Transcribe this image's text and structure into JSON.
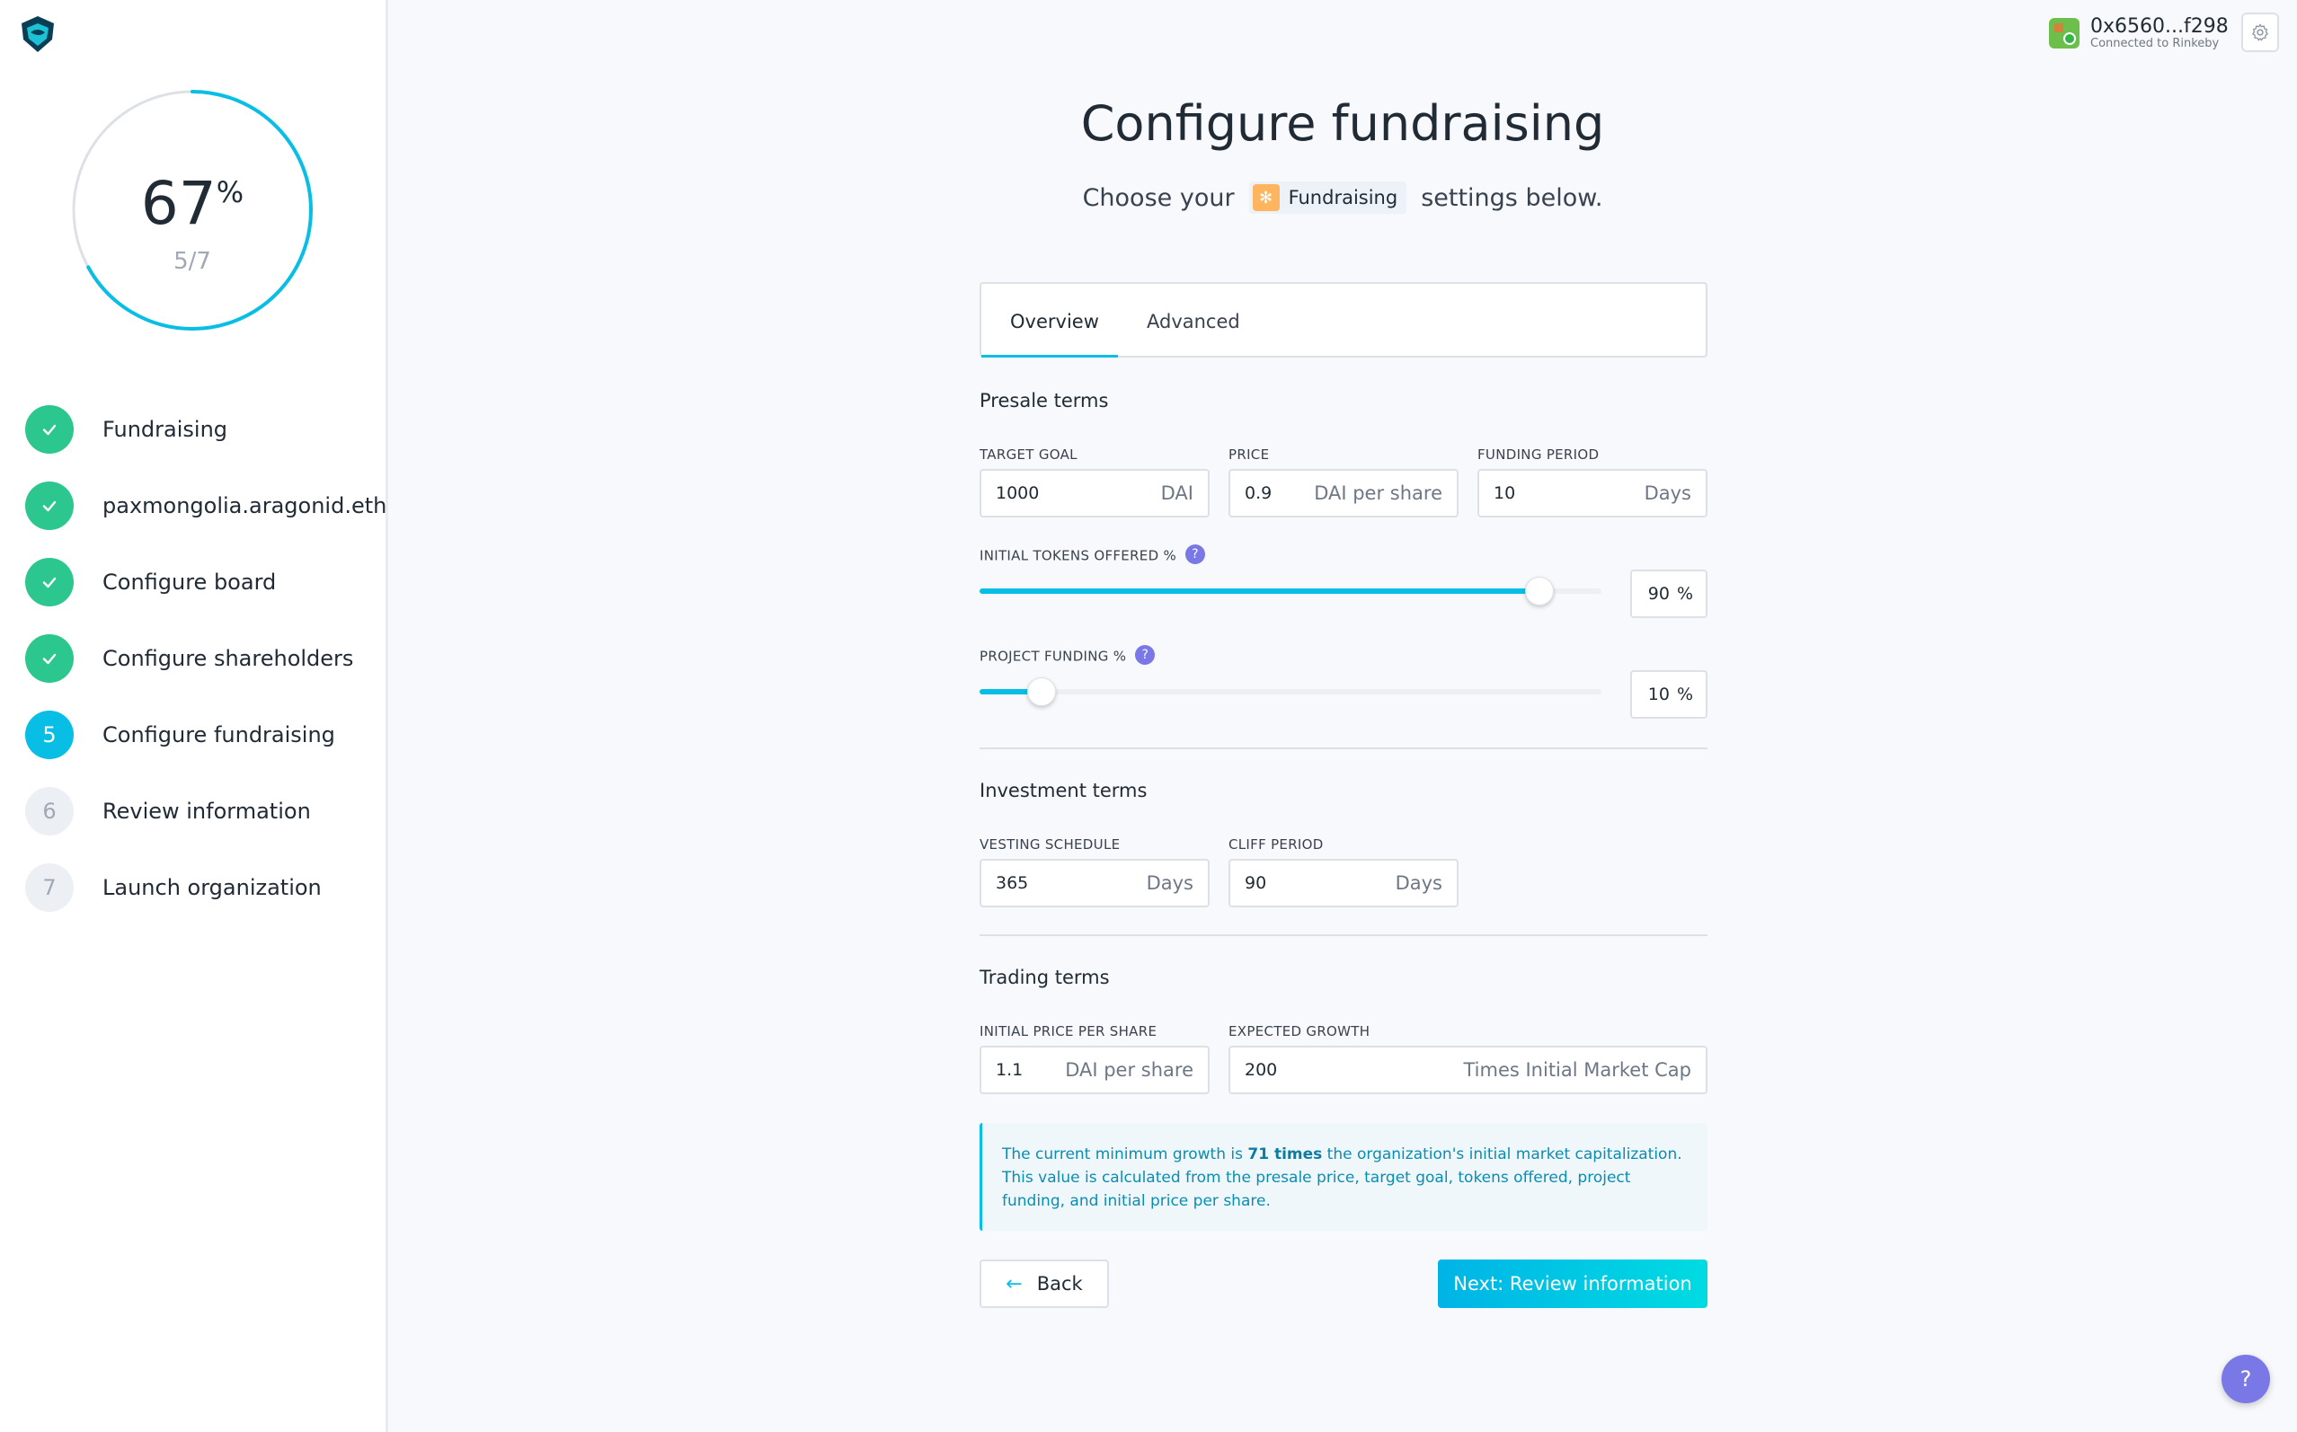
{
  "progress": {
    "percent": "67",
    "percent_sign": "%",
    "step": "5/7",
    "fraction": 0.67
  },
  "steps": [
    {
      "label": "Fundraising",
      "status": "done",
      "number": ""
    },
    {
      "label": "paxmongolia.aragonid.eth",
      "status": "done",
      "number": ""
    },
    {
      "label": "Configure board",
      "status": "done",
      "number": ""
    },
    {
      "label": "Configure shareholders",
      "status": "done",
      "number": ""
    },
    {
      "label": "Configure fundraising",
      "status": "active",
      "number": "5"
    },
    {
      "label": "Review information",
      "status": "pending",
      "number": "6"
    },
    {
      "label": "Launch organization",
      "status": "pending",
      "number": "7"
    }
  ],
  "account": {
    "address": "0x6560...f298",
    "network": "Connected to Rinkeby"
  },
  "header": {
    "title": "Configure fundraising",
    "subtitle_prefix": "Choose your",
    "badge": "Fundraising",
    "subtitle_suffix": "settings below."
  },
  "tabs": {
    "overview": "Overview",
    "advanced": "Advanced"
  },
  "presale": {
    "title": "Presale terms",
    "target_goal": {
      "label": "TARGET GOAL",
      "value": "1000",
      "unit": "DAI"
    },
    "price": {
      "label": "PRICE",
      "value": "0.9",
      "unit": "DAI per share"
    },
    "funding_period": {
      "label": "FUNDING PERIOD",
      "value": "10",
      "unit": "Days"
    },
    "tokens_offered": {
      "label": "INITIAL TOKENS OFFERED %",
      "value": "90",
      "unit": "%",
      "fraction": 0.9
    },
    "project_funding": {
      "label": "PROJECT FUNDING %",
      "value": "10",
      "unit": "%",
      "fraction": 0.1
    }
  },
  "investment": {
    "title": "Investment terms",
    "vesting": {
      "label": "VESTING SCHEDULE",
      "value": "365",
      "unit": "Days"
    },
    "cliff": {
      "label": "CLIFF PERIOD",
      "value": "90",
      "unit": "Days"
    }
  },
  "trading": {
    "title": "Trading terms",
    "initial_price": {
      "label": "INITIAL PRICE PER SHARE",
      "value": "1.1",
      "unit": "DAI per share"
    },
    "growth": {
      "label": "EXPECTED GROWTH",
      "value": "200",
      "unit": "Times Initial Market Cap"
    }
  },
  "info": {
    "text_before": "The current minimum growth is ",
    "highlight": "71 times",
    "text_after": " the organization's initial market capitalization. This value is calculated from the presale price, target goal, tokens offered, project funding, and initial price per share."
  },
  "buttons": {
    "back": "Back",
    "next": "Next: Review information",
    "help": "?",
    "help_small": "?"
  },
  "icons": {
    "check": "check-icon",
    "gear": "gear-icon",
    "arrow_left": "arrow-left-icon"
  },
  "colors": {
    "accent": "#08bee5",
    "success": "#2cc68f",
    "help": "#7a78e6"
  }
}
